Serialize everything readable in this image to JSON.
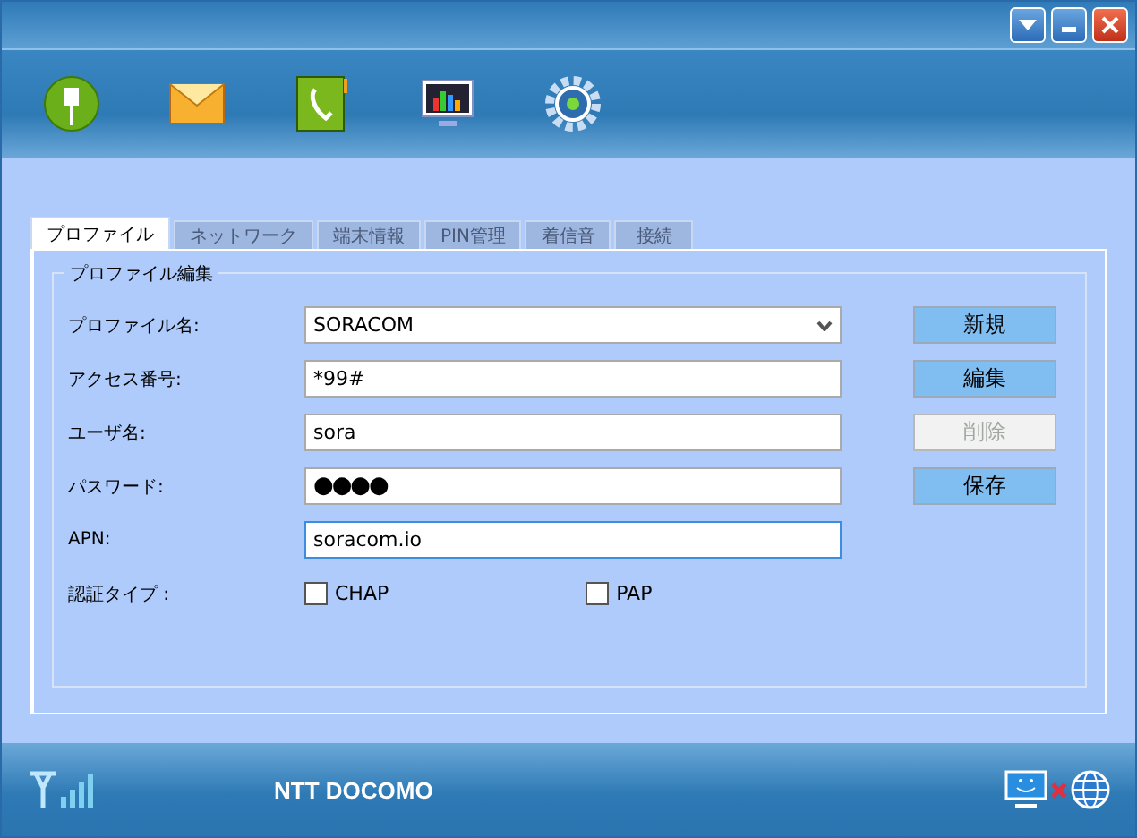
{
  "tabs": [
    {
      "label": "プロファイル",
      "selected": true
    },
    {
      "label": "ネットワーク",
      "selected": false
    },
    {
      "label": "端末情報",
      "selected": false
    },
    {
      "label": "PIN管理",
      "selected": false
    },
    {
      "label": "着信音",
      "selected": false
    },
    {
      "label": "接続",
      "selected": false
    }
  ],
  "profile_group": {
    "title": "プロファイル編集",
    "fields": [
      {
        "label": "プロファイル名:",
        "kind": "dropdown",
        "value": "SORACOM",
        "focused": false
      },
      {
        "label": "アクセス番号:",
        "kind": "text",
        "value": "*99#",
        "focused": false
      },
      {
        "label": "ユーザ名:",
        "kind": "text",
        "value": "sora",
        "focused": false
      },
      {
        "label": "パスワード:",
        "kind": "password",
        "value": "●●●●",
        "focused": false
      },
      {
        "label": "APN:",
        "kind": "text",
        "value": "soracom.io",
        "focused": true
      }
    ],
    "auth": {
      "label": "認証タイプ :",
      "options": [
        {
          "label": "CHAP",
          "checked": false
        },
        {
          "label": "PAP",
          "checked": false
        }
      ]
    },
    "buttons": [
      {
        "label": "新規",
        "disabled": false
      },
      {
        "label": "編集",
        "disabled": false
      },
      {
        "label": "削除",
        "disabled": true
      },
      {
        "label": "保存",
        "disabled": false
      }
    ]
  },
  "status_bar": {
    "carrier": "NTT DOCOMO"
  }
}
